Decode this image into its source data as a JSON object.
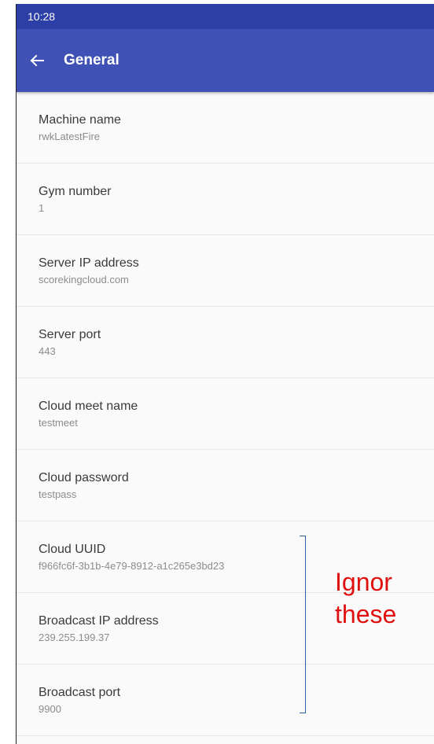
{
  "status_bar": {
    "time": "10:28"
  },
  "app_bar": {
    "title": "General"
  },
  "settings": [
    {
      "title": "Machine name",
      "value": "rwkLatestFire"
    },
    {
      "title": "Gym number",
      "value": "1"
    },
    {
      "title": "Server IP address",
      "value": "scorekingcloud.com"
    },
    {
      "title": "Server port",
      "value": "443"
    },
    {
      "title": "Cloud meet name",
      "value": "testmeet"
    },
    {
      "title": "Cloud password",
      "value": "testpass"
    },
    {
      "title": "Cloud UUID",
      "value": "f966fc6f-3b1b-4e79-8912-a1c265e3bd23"
    },
    {
      "title": "Broadcast IP address",
      "value": "239.255.199.37"
    },
    {
      "title": "Broadcast port",
      "value": "9900"
    }
  ],
  "annotation": {
    "line1": "Ignor",
    "line2": "these"
  },
  "colors": {
    "status_bar": "#2b3fa6",
    "app_bar": "#3f51b5",
    "annotation": "#e01010",
    "bracket": "#2f5fa8"
  }
}
